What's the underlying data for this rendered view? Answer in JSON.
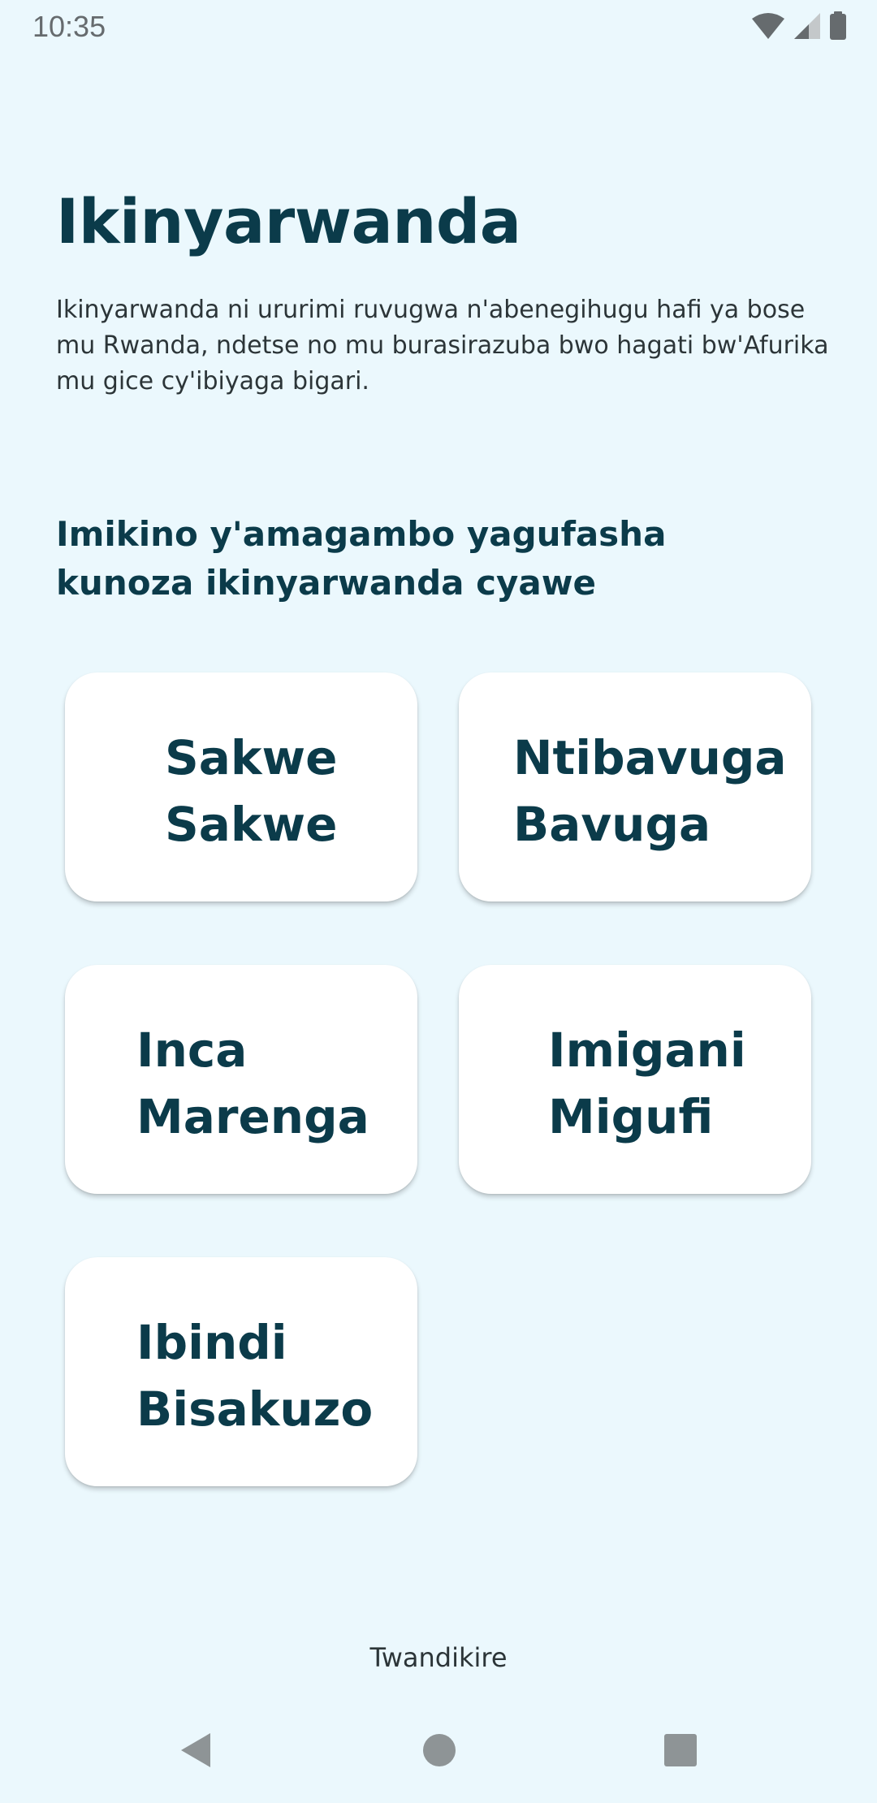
{
  "status_bar": {
    "time": "10:35",
    "icons": [
      "wifi-icon",
      "cellular-signal-icon",
      "battery-icon"
    ],
    "icon_color": "#666b6e"
  },
  "page": {
    "title": "Ikinyarwanda",
    "description": "Ikinyarwanda ni ururimi ruvugwa n'abenegihugu hafi ya bose mu Rwanda, ndetse no mu burasirazuba bwo hagati bw'Afurika mu gice cy'ibiyaga bigari.",
    "subtitle": "Imikino y'amagambo yagufasha kunoza ikinyarwanda cyawe"
  },
  "games": [
    {
      "label": "Sakwe\nSakwe"
    },
    {
      "label": "Ntibavuga\nBavuga"
    },
    {
      "label": "Inca\nMarenga"
    },
    {
      "label": "Imigani\nMigufi"
    },
    {
      "label": "Ibindi\nBisakuzo"
    }
  ],
  "footer": {
    "link_label": "Twandikire"
  },
  "nav_bar": {
    "icons": [
      "back-icon",
      "home-icon",
      "recents-icon"
    ],
    "icon_color": "#8e9496"
  },
  "colors": {
    "background": "#ebf8fd",
    "primary_text": "#0b3b4a",
    "card_background": "#ffffff"
  }
}
